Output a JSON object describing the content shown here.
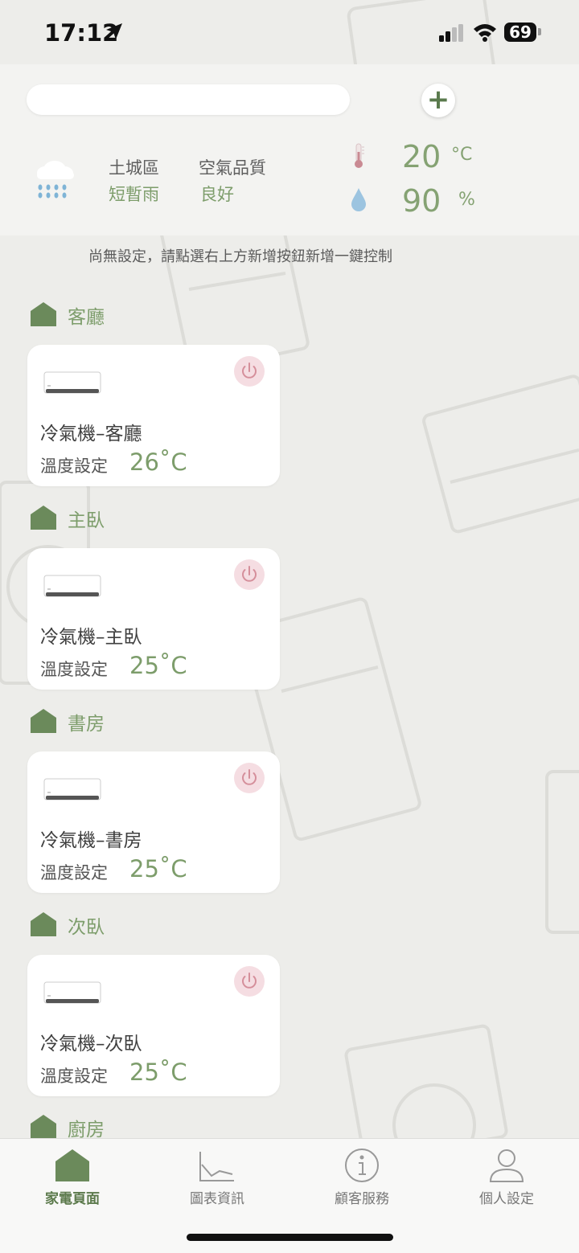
{
  "status_bar": {
    "time": "17:12",
    "battery": "69"
  },
  "header": {
    "search": {
      "placeholder": ""
    },
    "add_label": "+",
    "district": "土城區",
    "weather": "短暫雨",
    "air_quality_label": "空氣品質",
    "air_quality_value": "良好",
    "temperature": "20",
    "temperature_unit": "°C",
    "humidity": "90",
    "humidity_unit": "%"
  },
  "hint": "尚無設定，請點選右上方新增按鈕新增一鍵控制",
  "rooms": [
    {
      "name": "客廳",
      "device": "冷氣機–客廳",
      "set_label": "溫度設定",
      "temp": "26˚C"
    },
    {
      "name": "主臥",
      "device": "冷氣機–主臥",
      "set_label": "溫度設定",
      "temp": "25˚C"
    },
    {
      "name": "書房",
      "device": "冷氣機–書房",
      "set_label": "溫度設定",
      "temp": "25˚C"
    },
    {
      "name": "次臥",
      "device": "冷氣機–次臥",
      "set_label": "溫度設定",
      "temp": "25˚C"
    },
    {
      "name": "廚房"
    }
  ],
  "tabbar": [
    {
      "label": "家電頁面",
      "icon": "home-icon",
      "active": true
    },
    {
      "label": "圖表資訊",
      "icon": "chart-icon",
      "active": false
    },
    {
      "label": "顧客服務",
      "icon": "info-icon",
      "active": false
    },
    {
      "label": "個人設定",
      "icon": "person-icon",
      "active": false
    }
  ],
  "colors": {
    "accent": "#7d9d6b",
    "power_bg": "#f5dde2",
    "power_icon": "#d58f9b",
    "background": "#ededea"
  }
}
